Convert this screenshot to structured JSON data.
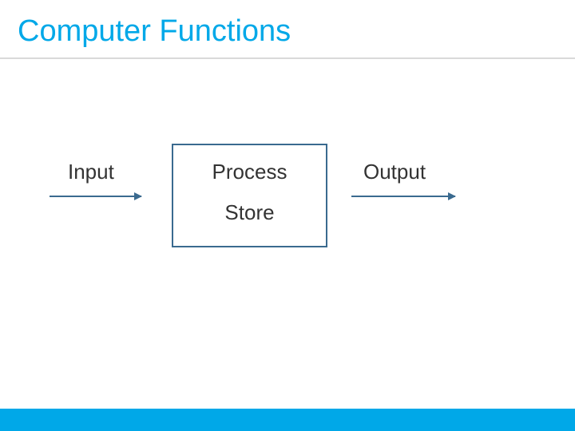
{
  "title": "Computer Functions",
  "diagram": {
    "input_label": "Input",
    "output_label": "Output",
    "center": {
      "process_label": "Process",
      "store_label": "Store"
    }
  },
  "colors": {
    "accent": "#00a8e8",
    "box_border": "#3a6a8f",
    "text": "#333333",
    "underline": "#d9d9d9"
  }
}
